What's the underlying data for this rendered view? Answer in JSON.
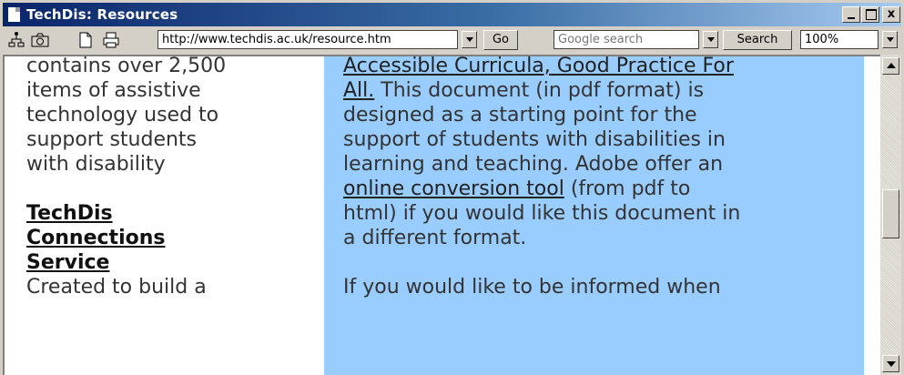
{
  "window": {
    "title": "TechDis: Resources",
    "min_symbol": "_",
    "max_symbol": "□",
    "close_symbol": "x"
  },
  "toolbar": {
    "icons": [
      "network-icon",
      "camera-icon",
      "new-page-icon",
      "print-icon"
    ],
    "address_value": "http://www.techdis.ac.uk/resource.htm",
    "go_label": "Go",
    "search_placeholder": "Google search",
    "search_label": "Search",
    "zoom_value": "100%"
  },
  "content": {
    "left": {
      "intro_lines": [
        "contains over 2,500",
        "items of assistive",
        "technology used to",
        "support students",
        "with disability"
      ],
      "link_lines": [
        "TechDis",
        "Connections",
        "Service"
      ],
      "trailing": "Created to build a"
    },
    "right": {
      "link1_line1": "Accessible Curricula, Good Practice For",
      "link1_line2": "All.",
      "after_link1": " This document (in pdf format) is",
      "lines": [
        "designed as a starting point for the",
        "support of students with disabilities in",
        "learning and teaching. Adobe offer an"
      ],
      "link2": "online conversion tool",
      "after_link2": " (from pdf to",
      "lines2": [
        "html) if you would like this document in",
        "a different format."
      ],
      "trailing": "If you would like to be informed when"
    }
  },
  "colors": {
    "titlebar_start": "#0a246a",
    "titlebar_end": "#a6caf0",
    "content_highlight": "#99ccff",
    "chrome": "#d4d0c8"
  }
}
